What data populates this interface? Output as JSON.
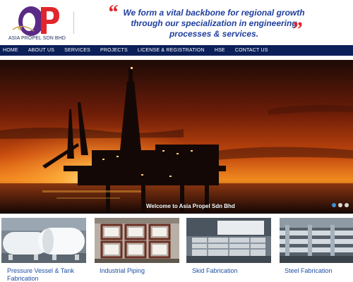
{
  "company": {
    "logo_text": "ASIA PROPEL SDN BHD",
    "tagline": "We form a vital backbone for regional growth through our specialization in engineering processes & services.",
    "brand_red": "#e0262c",
    "brand_blue": "#1f3f9d",
    "brand_purple": "#5b2a86"
  },
  "nav": {
    "background": "#0b1f59",
    "items": [
      {
        "label": "HOME"
      },
      {
        "label": "ABOUT US"
      },
      {
        "label": "SERVICES"
      },
      {
        "label": "PROJECTS"
      },
      {
        "label": "LICENSE & REGISTRATION"
      },
      {
        "label": "HSE"
      },
      {
        "label": "CONTACT US"
      }
    ]
  },
  "hero": {
    "caption": "Welcome to Asia Propel Sdn Bhd",
    "image_subject": "offshore oil rig at sunset",
    "slider_dots": [
      {
        "active": true
      },
      {
        "active": false
      },
      {
        "active": false
      }
    ]
  },
  "services": [
    {
      "label": "Pressure Vessel & Tank Fabrication",
      "image_subject": "white pressure vessels"
    },
    {
      "label": "Industrial Piping",
      "image_subject": "industrial piping frames"
    },
    {
      "label": "Skid Fabrication",
      "image_subject": "skid fabrication"
    },
    {
      "label": "Steel Fabrication",
      "image_subject": "steel fabrication pipes"
    }
  ],
  "icons": [
    "logo-icon",
    "quote-open-icon",
    "quote-close-icon"
  ]
}
